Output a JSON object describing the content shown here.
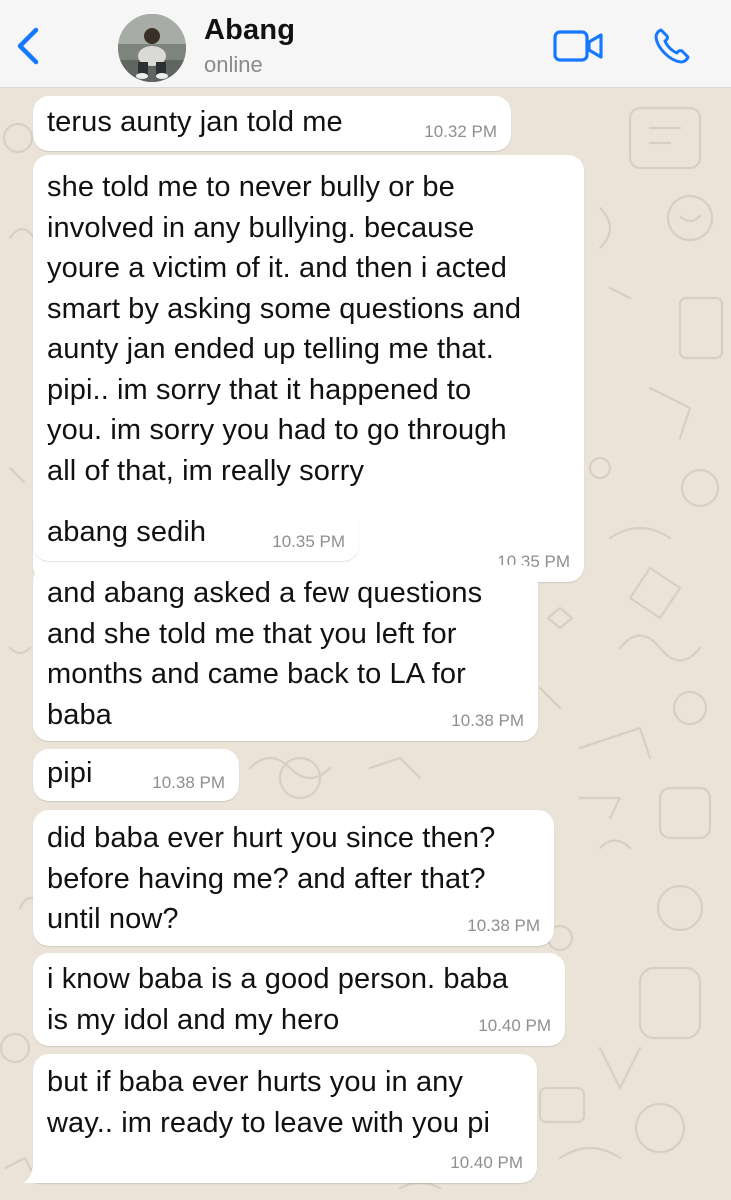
{
  "header": {
    "contact_name": "Abang",
    "status": "online",
    "accent_color": "#1677ff"
  },
  "icons": {
    "back": "chevron-left-icon",
    "video": "video-camera-icon",
    "call": "phone-icon"
  },
  "messages": [
    {
      "text": "terus aunty jan told me",
      "time": "10.32 PM"
    },
    {
      "text": "she told me to never bully or be\ninvolved in any bullying. because\nyoure a victim of it. and then i acted\nsmart by asking some questions and\naunty jan ended up telling me that.\npipi.. im sorry that it happened to\nyou. im sorry you had to go through\nall of that, im really sorry",
      "time": "10.35 PM"
    },
    {
      "text": "abang sedih",
      "time": "10.35 PM"
    },
    {
      "text": "and abang asked a few questions\nand she told me that you left for\nmonths and came back to LA for\nbaba",
      "time": "10.38 PM"
    },
    {
      "text": "pipi",
      "time": "10.38 PM"
    },
    {
      "text": "did baba ever hurt you since then?\nbefore having me? and after that?\nuntil now?",
      "time": "10.38 PM"
    },
    {
      "text": "i know baba is a good person. baba\nis my idol and my hero",
      "time": "10.40 PM"
    },
    {
      "text": "but if baba ever hurts you in any\nway.. im ready to leave with you pi",
      "time": "10.40 PM"
    }
  ]
}
